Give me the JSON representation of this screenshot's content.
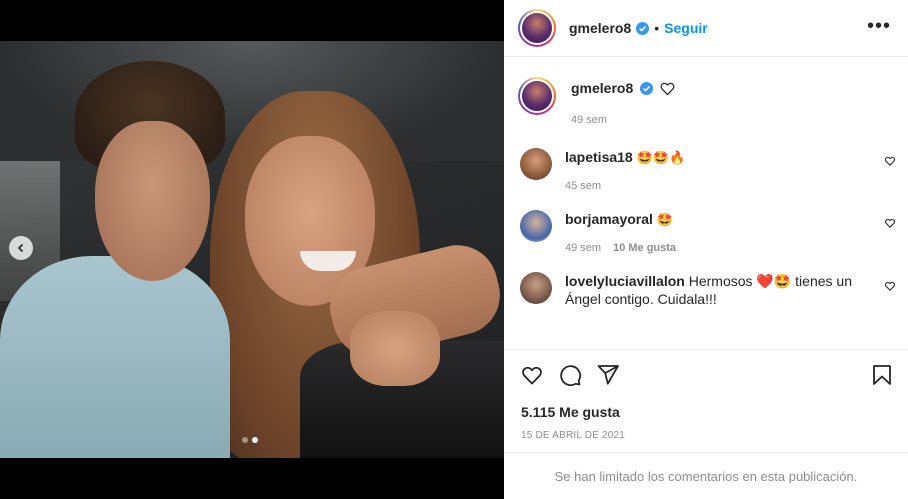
{
  "post": {
    "username": "gmelero8",
    "follow_label": "Seguir",
    "separator": "•",
    "more_label": "•••",
    "photo_count": 2,
    "photo_active_index": 1
  },
  "caption": {
    "username": "gmelero8",
    "time": "49 sem"
  },
  "comments": [
    {
      "username": "lapetisa18",
      "text": "🤩🤩🔥",
      "time": "45 sem",
      "likes": ""
    },
    {
      "username": "borjamayoral",
      "text": "🤩",
      "time": "49 sem",
      "likes": "10 Me gusta"
    },
    {
      "username": "lovelyluciavillalon",
      "text": "Hermosos ❤️🤩 tienes un Ángel contigo. Cuidala!!!",
      "time": "",
      "likes": ""
    }
  ],
  "stats": {
    "likes": "5.115 Me gusta",
    "date": "15 DE ABRIL DE 2021"
  },
  "footer": {
    "limited_text": "Se han limitado los comentarios en esta publicación."
  },
  "colors": {
    "accent": "#0095f6",
    "verified": "#3897f0",
    "muted": "#8e8e8e",
    "heart_red": "#ed4956"
  }
}
